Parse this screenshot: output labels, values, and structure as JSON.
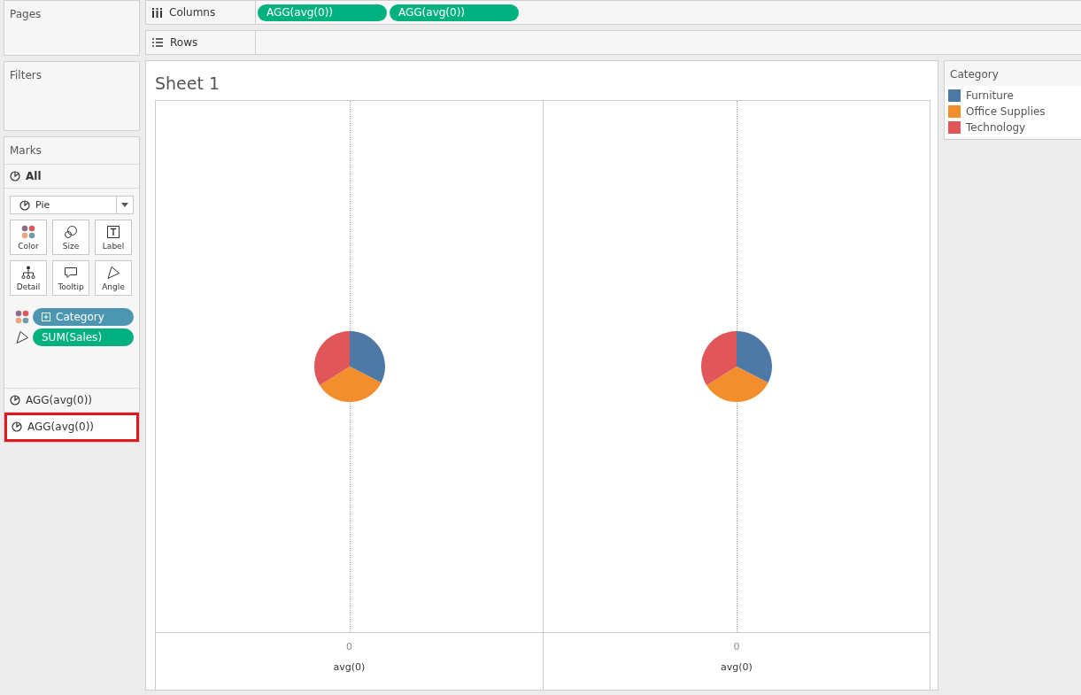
{
  "pages_card": {
    "title": "Pages"
  },
  "filters_card": {
    "title": "Filters"
  },
  "columns_shelf": {
    "label": "Columns",
    "pills": [
      {
        "label": "AGG(avg(0))",
        "discrete": false
      },
      {
        "label": "AGG(avg(0))",
        "discrete": false
      }
    ]
  },
  "rows_shelf": {
    "label": "Rows"
  },
  "marks_card": {
    "title": "Marks",
    "all_layer": {
      "label": "All",
      "selected": true
    },
    "mark_type": "Pie",
    "buttons": [
      {
        "label": "Color",
        "kind": "color"
      },
      {
        "label": "Size",
        "kind": "size"
      },
      {
        "label": "Label",
        "kind": "label"
      },
      {
        "label": "Detail",
        "kind": "detail"
      },
      {
        "label": "Tooltip",
        "kind": "tooltip"
      },
      {
        "label": "Angle",
        "kind": "angle"
      }
    ],
    "encodings": [
      {
        "kind": "color",
        "label": "Category",
        "discrete": true
      },
      {
        "kind": "angle",
        "label": "SUM(Sales)",
        "discrete": false
      }
    ],
    "layers": [
      {
        "label": "AGG(avg(0))",
        "selected": false,
        "highlighted": false
      },
      {
        "label": "AGG(avg(0))",
        "selected": false,
        "highlighted": true
      }
    ]
  },
  "sheet": {
    "title": "Sheet 1",
    "panes": [
      {
        "axis_tick": "0",
        "axis_title": "avg(0)"
      },
      {
        "axis_tick": "0",
        "axis_title": "avg(0)"
      }
    ]
  },
  "legend": {
    "title": "Category",
    "items": [
      {
        "label": "Furniture",
        "color": "#4e79a7"
      },
      {
        "label": "Office Supplies",
        "color": "#f28e2b"
      },
      {
        "label": "Technology",
        "color": "#e15759"
      }
    ]
  }
}
